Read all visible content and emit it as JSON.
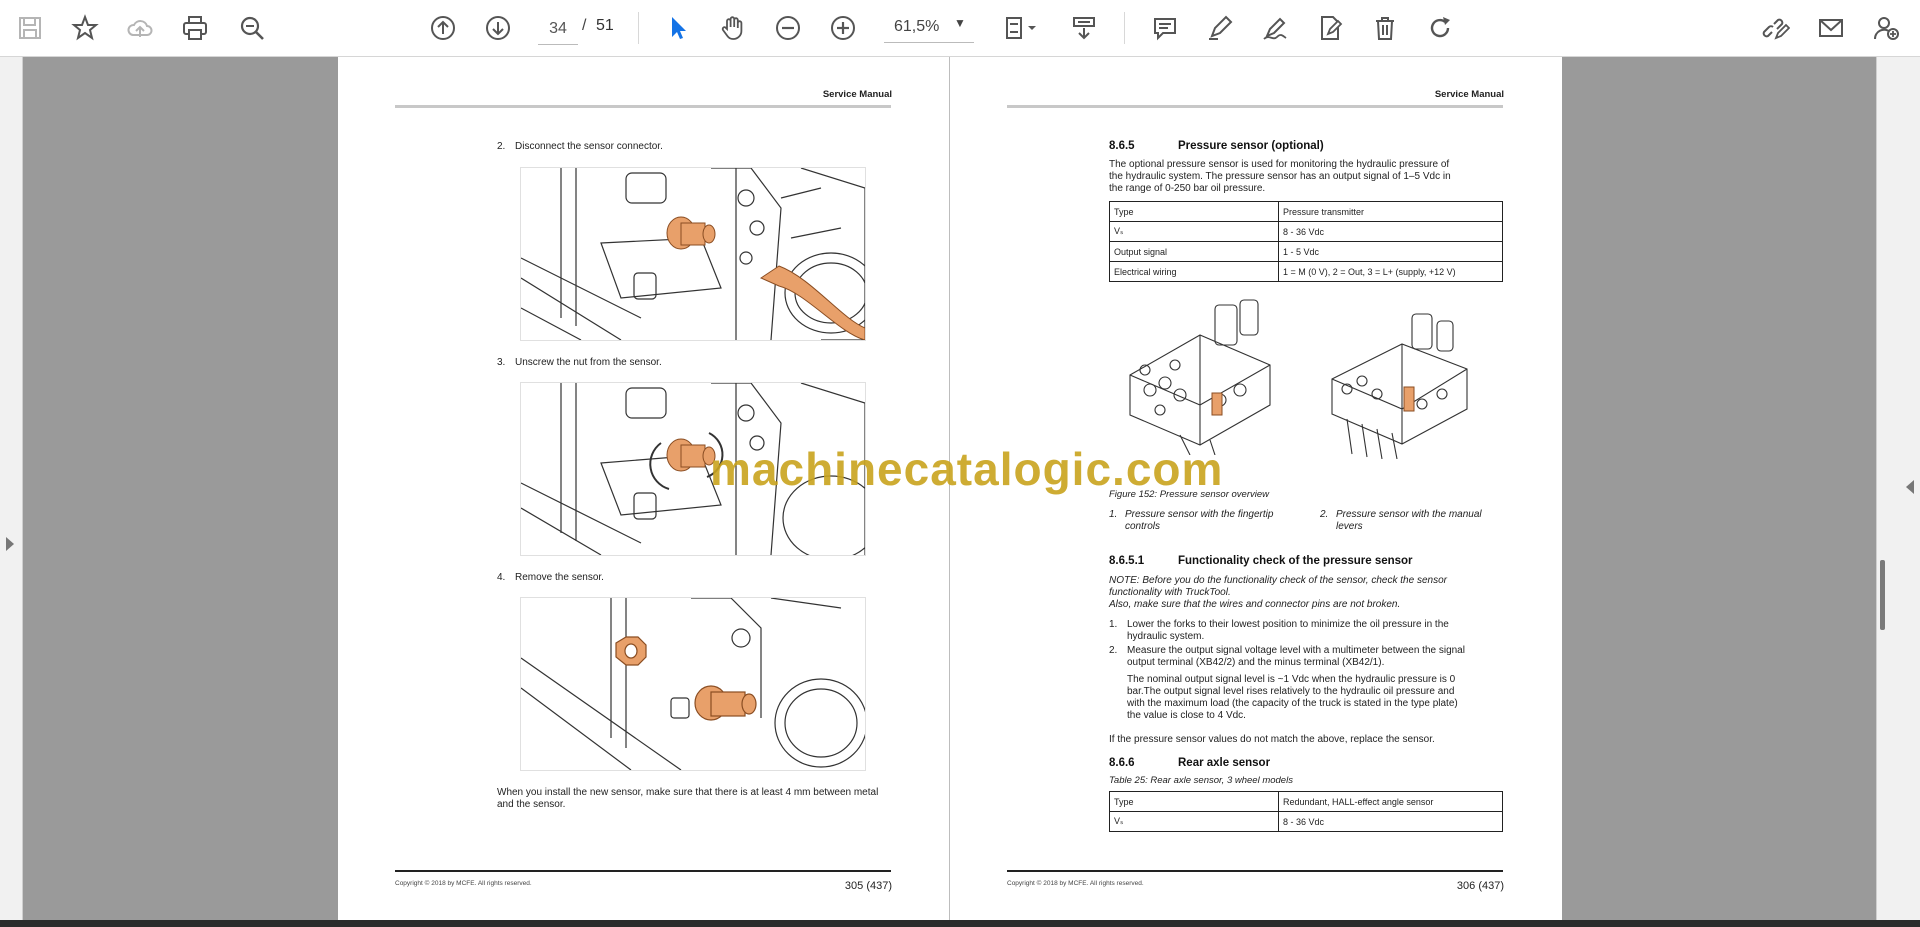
{
  "toolbar": {
    "page_current": "34",
    "page_separator": "/",
    "page_total": "51",
    "zoom": "61,5%",
    "zoom_caret": "▼"
  },
  "watermark": "machinecatalogic.com",
  "left_page": {
    "header": "Service Manual",
    "steps": [
      {
        "num": "2.",
        "text": "Disconnect the sensor connector."
      },
      {
        "num": "3.",
        "text": "Unscrew the nut from the sensor."
      },
      {
        "num": "4.",
        "text": "Remove the sensor."
      }
    ],
    "install_note_1": "When you install the new sensor, make sure that there is at least 4 mm between metal",
    "install_note_2": "and the sensor.",
    "copyright": "Copyright © 2018 by MCFE. All rights reserved.",
    "page_number": "305 (437)"
  },
  "right_page": {
    "header": "Service Manual",
    "s1_num": "8.6.5",
    "s1_title": "Pressure sensor (optional)",
    "s1_p1": "The optional pressure sensor is used for monitoring the hydraulic pressure of",
    "s1_p2": "the hydraulic system. The pressure sensor has an output signal of 1–5 Vdc in",
    "s1_p3": "the range of 0-250 bar oil pressure.",
    "table1": [
      [
        "Type",
        "Pressure transmitter"
      ],
      [
        "Vₛ",
        "8 - 36 Vdc"
      ],
      [
        "Output signal",
        "1 - 5 Vdc"
      ],
      [
        "Electrical wiring",
        "1 = M (0 V), 2 = Out, 3 = L+ (supply, +12 V)"
      ]
    ],
    "figure_caption": "Figure 152: Pressure sensor overview",
    "fig_items": [
      {
        "num": "1.",
        "l1": "Pressure sensor with the fingertip",
        "l2": "controls"
      },
      {
        "num": "2.",
        "l1": "Pressure sensor with the manual",
        "l2": "levers"
      }
    ],
    "s2_num": "8.6.5.1",
    "s2_title": "Functionality check of the pressure sensor",
    "note_1": "NOTE: Before you do the functionality check of the sensor, check the sensor",
    "note_2": "functionality with TruckTool.",
    "note_3": "Also, make sure that the wires and connector pins are not broken.",
    "check_steps": [
      {
        "num": "1.",
        "l1": "Lower the forks to their lowest position to minimize the oil pressure in the",
        "l2": "hydraulic system."
      },
      {
        "num": "2.",
        "l1": "Measure the output signal voltage level with a multimeter between the signal",
        "l2": "output terminal (XB42/2) and the minus terminal (XB42/1)."
      }
    ],
    "nominal_1": "The nominal output signal level is ~1 Vdc when the hydraulic pressure is 0",
    "nominal_2": "bar.The output signal level rises relatively to the hydraulic oil pressure and",
    "nominal_3": "with the maximum load (the capacity of the truck is stated in the type plate)",
    "nominal_4": "the value is close to 4 Vdc.",
    "replace_note": "If the pressure sensor values do not match the above, replace the sensor.",
    "s3_num": "8.6.6",
    "s3_title": "Rear axle sensor",
    "table2_caption": "Table 25:  Rear axle sensor, 3 wheel models",
    "table2": [
      [
        "Type",
        "Redundant, HALL-effect angle sensor"
      ],
      [
        "Vₛ",
        "8 - 36 Vdc"
      ]
    ],
    "copyright": "Copyright © 2018 by MCFE. All rights reserved.",
    "page_number": "306 (437)"
  },
  "colors": {
    "accent_icon": "#1473e6",
    "sensor_orange": "#e8a06a",
    "watermark": "#c9a41e"
  }
}
